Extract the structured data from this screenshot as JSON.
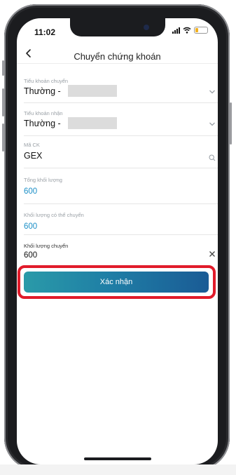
{
  "status_bar": {
    "time": "11:02"
  },
  "nav": {
    "title": "Chuyển chứng khoán"
  },
  "form": {
    "source_account": {
      "label": "Tiểu khoản chuyển",
      "value": "Thường -"
    },
    "dest_account": {
      "label": "Tiểu khoản nhận",
      "value": "Thường -"
    },
    "stock_code": {
      "label": "Mã CK",
      "value": "GEX"
    },
    "total_volume": {
      "label": "Tổng khối lượng",
      "value": "600"
    },
    "transferable_volume": {
      "label": "Khối lượng có thể chuyển",
      "value": "600"
    },
    "transfer_volume": {
      "label": "Khối lượng chuyển",
      "value": "600"
    }
  },
  "confirm": {
    "label": "Xác nhận"
  },
  "colors": {
    "accent_value": "#1b8fc7",
    "button_start": "#2a9aa8",
    "button_end": "#1a5b95",
    "highlight": "#e11b2a"
  },
  "icons": [
    "back-chevron-icon",
    "chevron-down-icon",
    "search-icon",
    "clear-icon",
    "signal-icon",
    "wifi-icon",
    "battery-icon"
  ]
}
